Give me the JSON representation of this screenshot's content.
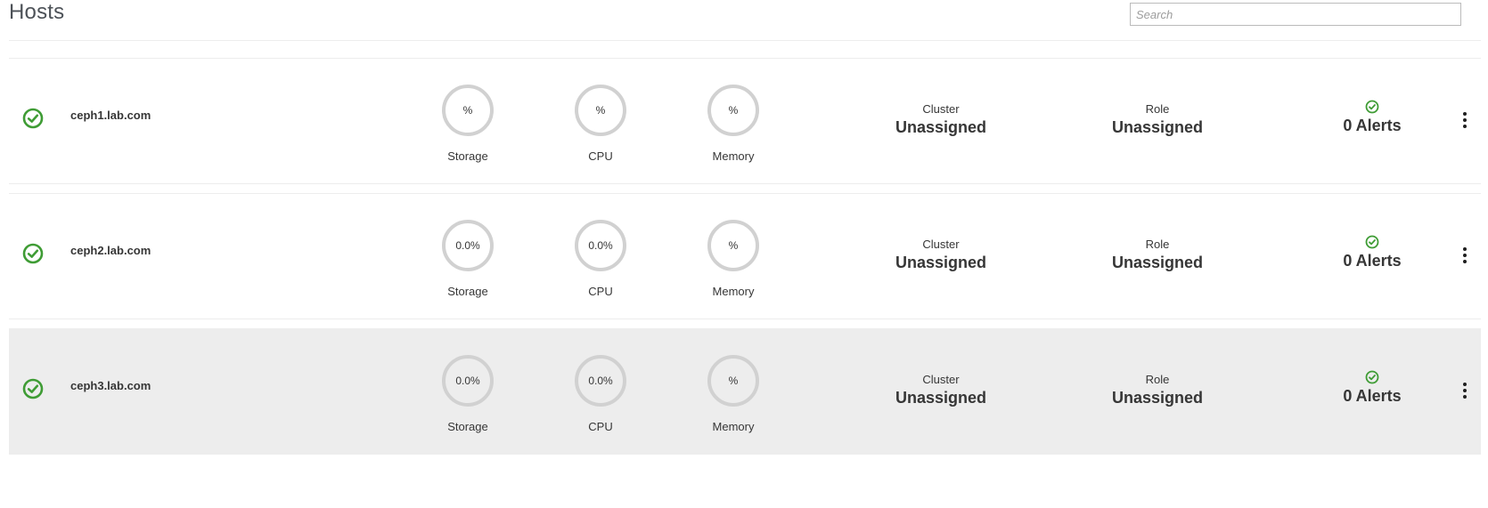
{
  "page": {
    "title": "Hosts",
    "search_placeholder": "Search",
    "search_value": ""
  },
  "colors": {
    "status_ok": "#3f9c35",
    "ring": "#d1d1d1",
    "selected_row": "#ededed"
  },
  "hosts": [
    {
      "name": "ceph1.lab.com",
      "status_icon": "ok-circle-icon",
      "storage": "%",
      "cpu": "%",
      "memory": "%",
      "storage_label": "Storage",
      "cpu_label": "CPU",
      "memory_label": "Memory",
      "cluster_label": "Cluster",
      "cluster_value": "Unassigned",
      "role_label": "Role",
      "role_value": "Unassigned",
      "alerts": "0 Alerts"
    },
    {
      "name": "ceph2.lab.com",
      "status_icon": "ok-circle-icon",
      "storage": "0.0%",
      "cpu": "0.0%",
      "memory": "%",
      "storage_label": "Storage",
      "cpu_label": "CPU",
      "memory_label": "Memory",
      "cluster_label": "Cluster",
      "cluster_value": "Unassigned",
      "role_label": "Role",
      "role_value": "Unassigned",
      "alerts": "0 Alerts"
    },
    {
      "name": "ceph3.lab.com",
      "status_icon": "ok-circle-icon",
      "storage": "0.0%",
      "cpu": "0.0%",
      "memory": "%",
      "storage_label": "Storage",
      "cpu_label": "CPU",
      "memory_label": "Memory",
      "cluster_label": "Cluster",
      "cluster_value": "Unassigned",
      "role_label": "Role",
      "role_value": "Unassigned",
      "alerts": "0 Alerts"
    }
  ]
}
